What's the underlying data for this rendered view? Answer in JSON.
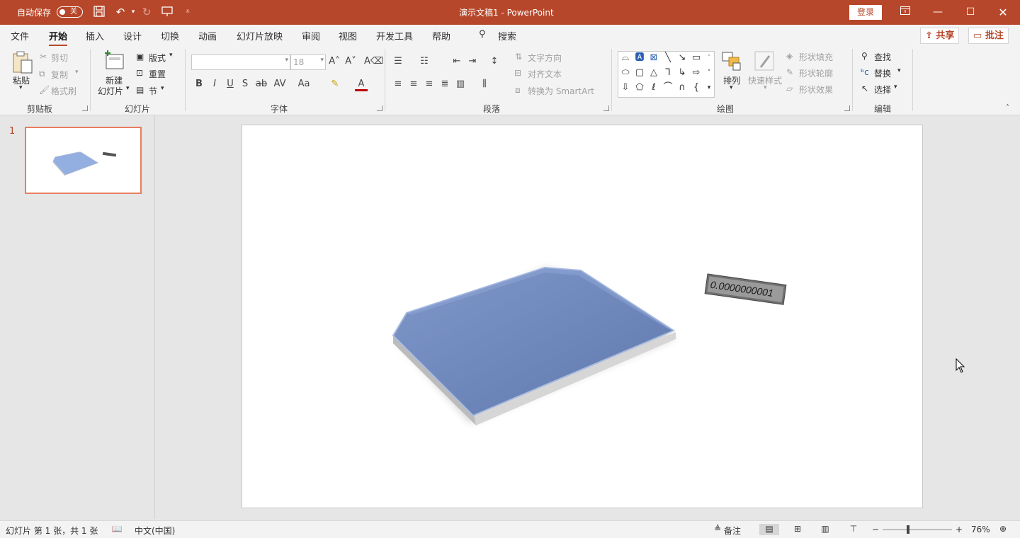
{
  "titlebar": {
    "autosave_label": "自动保存",
    "autosave_state": "关",
    "doc_title": "演示文稿1  -  PowerPoint",
    "login": "登录"
  },
  "tabs": [
    "文件",
    "开始",
    "插入",
    "设计",
    "切换",
    "动画",
    "幻灯片放映",
    "审阅",
    "视图",
    "开发工具",
    "帮助"
  ],
  "search_label": "搜索",
  "share_label": "共享",
  "comments_label": "批注",
  "ribbon": {
    "clipboard": {
      "group": "剪贴板",
      "paste": "粘贴",
      "cut": "剪切",
      "copy": "复制",
      "format_painter": "格式刷"
    },
    "slides": {
      "group": "幻灯片",
      "new_slide_1": "新建",
      "new_slide_2": "幻灯片",
      "layout": "版式",
      "reset": "重置",
      "section": "节"
    },
    "font": {
      "group": "字体",
      "font_size": "18"
    },
    "paragraph": {
      "group": "段落",
      "text_direction": "文字方向",
      "align_text": "对齐文本",
      "smartart": "转换为 SmartArt"
    },
    "drawing": {
      "group": "绘图",
      "arrange": "排列",
      "quick_styles": "快速样式",
      "shape_fill": "形状填充",
      "shape_outline": "形状轮廓",
      "shape_effects": "形状效果"
    },
    "editing": {
      "group": "编辑",
      "find": "查找",
      "replace": "替换",
      "select": "选择"
    }
  },
  "slides_pane": {
    "slide_number": "1"
  },
  "slide": {
    "label_text": "0.0000000001"
  },
  "status": {
    "slide_info": "幻灯片 第 1 张，共 1 张",
    "language": "中文(中国)",
    "notes": "备注",
    "zoom": "76%"
  },
  "colors": {
    "accent": "#b7472a",
    "shape_fill": "#6f88b8",
    "thumb_border": "#e97d5f"
  }
}
